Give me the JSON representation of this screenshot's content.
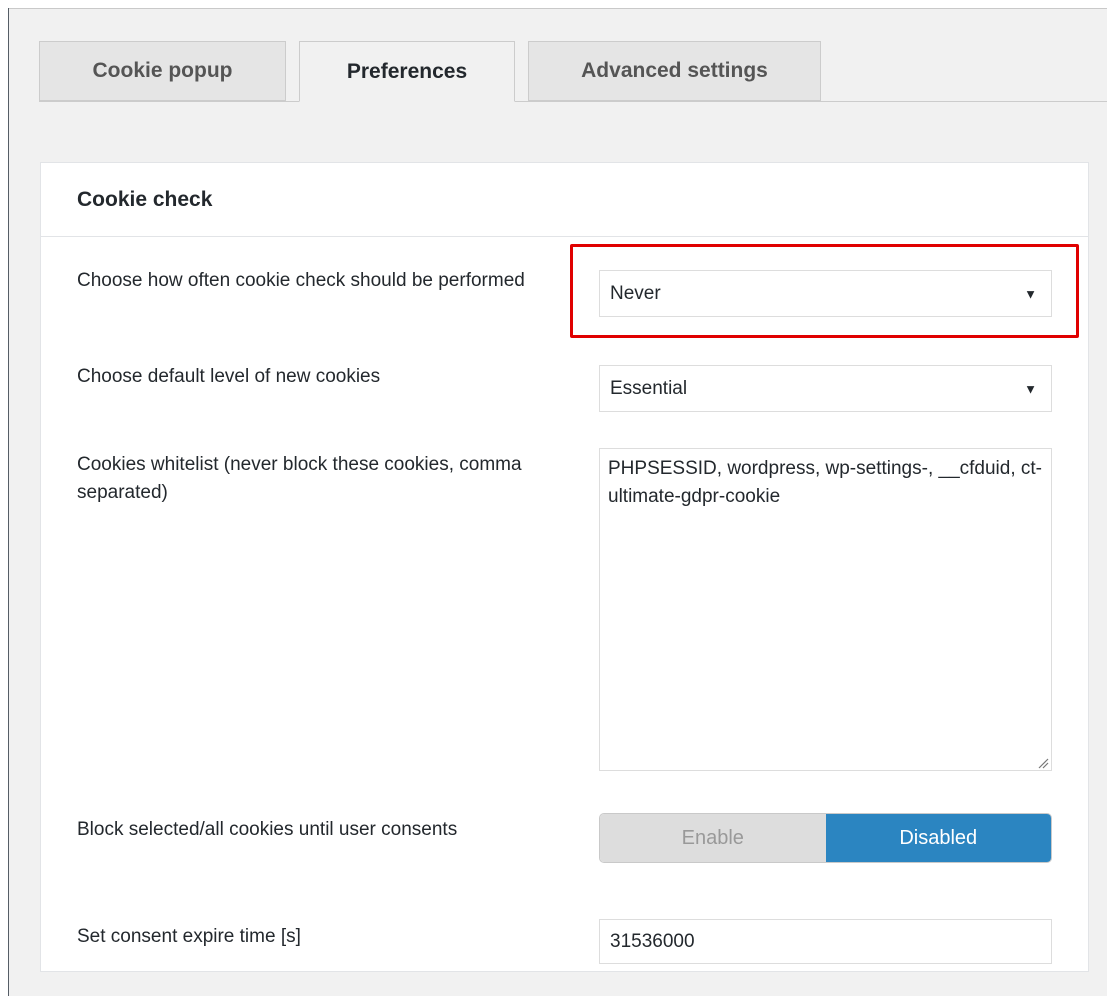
{
  "tabs": [
    {
      "label": "Cookie popup",
      "active": false
    },
    {
      "label": "Preferences",
      "active": true
    },
    {
      "label": "Advanced settings",
      "active": false
    }
  ],
  "section": {
    "title": "Cookie check"
  },
  "fields": {
    "check_frequency": {
      "label": "Choose how often cookie check should be performed",
      "value": "Never"
    },
    "default_level": {
      "label": "Choose default level of new cookies",
      "value": "Essential"
    },
    "whitelist": {
      "label": "Cookies whitelist (never block these cookies, comma separated)",
      "value": "PHPSESSID, wordpress, wp-settings-, __cfduid, ct-ultimate-gdpr-cookie"
    },
    "block_cookies": {
      "label": "Block selected/all cookies until user consents",
      "option_enable": "Enable",
      "option_disabled": "Disabled",
      "selected": "Disabled"
    },
    "expire_time": {
      "label": "Set consent expire time [s]",
      "value": "31536000"
    }
  },
  "colors": {
    "highlight": "#e00000",
    "toggle_active": "#2b85c1",
    "toggle_inactive": "#dddddd"
  },
  "icons": {
    "select_arrow": "caret-down-icon",
    "textarea_grip": "resize-grip-icon"
  }
}
